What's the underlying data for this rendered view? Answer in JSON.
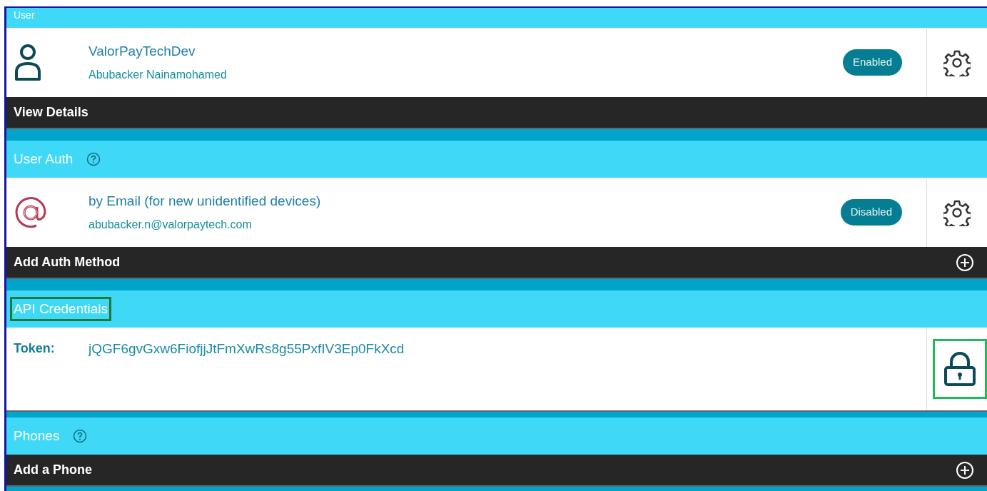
{
  "sections": [
    {
      "title": "User",
      "help": false,
      "highlighted": false,
      "rows": [
        {
          "kind": "user",
          "title": "ValorPayTechDev",
          "subtitle": "Abubacker Nainamohamed",
          "status": "Enabled"
        }
      ],
      "footer": {
        "label": "View Details",
        "add": false
      }
    },
    {
      "title": "User Auth",
      "help": true,
      "highlighted": false,
      "rows": [
        {
          "kind": "email",
          "title": "by Email (for new unidentified devices)",
          "subtitle": "abubacker.n@valorpaytech.com",
          "status": "Disabled"
        }
      ],
      "footer": {
        "label": "Add Auth Method",
        "add": true
      }
    },
    {
      "title": "API Credentials",
      "help": false,
      "highlighted": true,
      "rows": [
        {
          "kind": "token",
          "label": "Token:",
          "value": "jQGF6gvGxw6FiofjjJtFmXwRs8g55PxfIV3Ep0FkXcd",
          "lock_highlighted": true
        }
      ]
    },
    {
      "title": "Phones",
      "help": true,
      "highlighted": false,
      "footer": {
        "label": "Add a Phone",
        "add": true
      }
    }
  ]
}
